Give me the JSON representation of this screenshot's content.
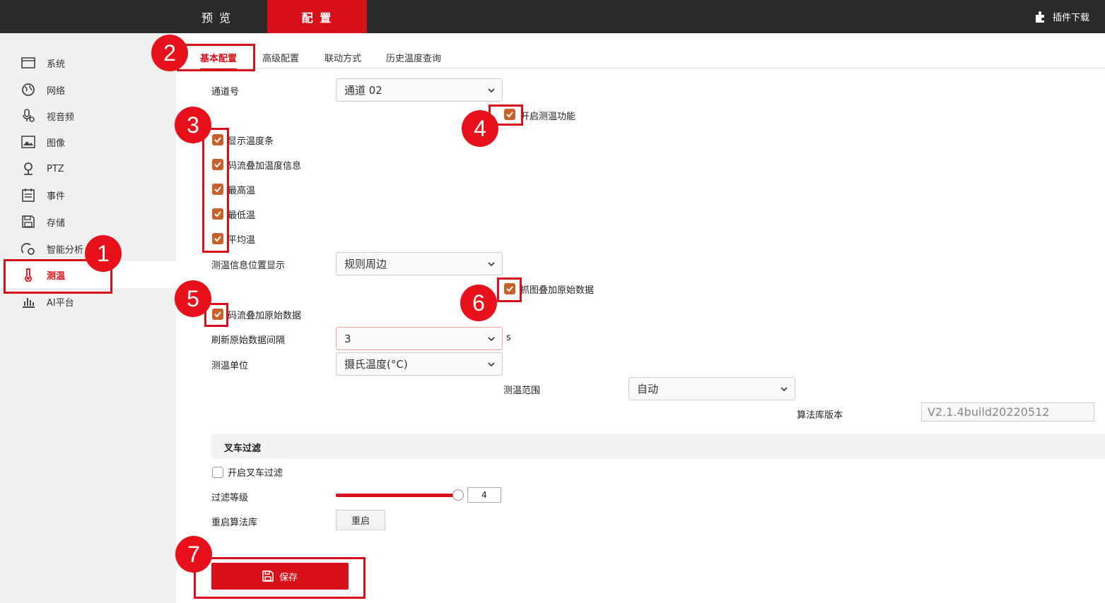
{
  "topbar": {
    "tabs": [
      {
        "label": "预 览"
      },
      {
        "label": "配 置"
      }
    ],
    "plugin_label": "插件下载"
  },
  "sidebar": {
    "items": [
      {
        "label": "系统",
        "icon": "monitor-icon"
      },
      {
        "label": "网络",
        "icon": "globe-icon"
      },
      {
        "label": "视音频",
        "icon": "microphone-icon"
      },
      {
        "label": "图像",
        "icon": "image-icon"
      },
      {
        "label": "PTZ",
        "icon": "ptz-icon"
      },
      {
        "label": "事件",
        "icon": "calendar-icon"
      },
      {
        "label": "存储",
        "icon": "save-icon"
      },
      {
        "label": "智能分析",
        "icon": "smart-analysis-icon"
      },
      {
        "label": "测温",
        "icon": "thermometer-icon"
      },
      {
        "label": "AI平台",
        "icon": "bar-chart-icon"
      }
    ],
    "active_index": 8
  },
  "tabs": [
    {
      "label": "基本配置"
    },
    {
      "label": "高级配置"
    },
    {
      "label": "联动方式"
    },
    {
      "label": "历史温度查询"
    }
  ],
  "form": {
    "channel_label": "通道号",
    "channel_value": "通道 02",
    "enable_temp_label": "开启测温功能",
    "display_checks": [
      {
        "label": "显示温度条",
        "checked": true
      },
      {
        "label": "码流叠加温度信息",
        "checked": true
      },
      {
        "label": "最高温",
        "checked": true
      },
      {
        "label": "最低温",
        "checked": true
      },
      {
        "label": "平均温",
        "checked": true
      }
    ],
    "position_label": "测温信息位置显示",
    "position_value": "规则周边",
    "snapshot_raw_label": "抓图叠加原始数据",
    "stream_raw_label": "码流叠加原始数据",
    "refresh_label": "刷新原始数据间隔",
    "refresh_value": "3",
    "refresh_unit": "s",
    "unit_label": "测温单位",
    "unit_value": "摄氏温度(°C)",
    "range_label": "测温范围",
    "range_value": "自动",
    "algo_version_label": "算法库版本",
    "algo_version_value": "V2.1.4build20220512"
  },
  "forklift": {
    "section_title": "叉车过滤",
    "enable_label": "开启叉车过滤",
    "enable_checked": false,
    "level_label": "过滤等级",
    "level_value": "4",
    "level_fraction": 1.0,
    "reboot_label": "重启算法库",
    "reboot_button": "重启"
  },
  "save_button": "保存",
  "annotations": [
    "1",
    "2",
    "3",
    "4",
    "5",
    "6",
    "7"
  ],
  "colors": {
    "accent": "#d8101a",
    "checkbox": "#c8602a",
    "topbar": "#2b2b2b"
  }
}
